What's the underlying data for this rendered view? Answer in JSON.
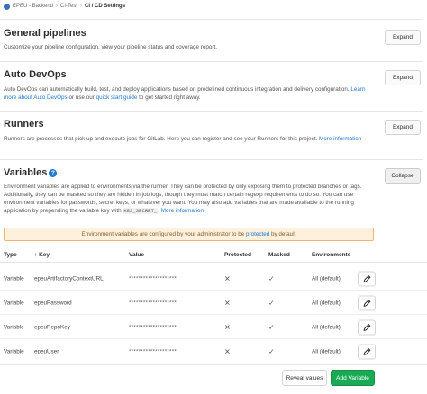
{
  "breadcrumb": {
    "items": [
      "EPEU - Backend",
      "CI-Test",
      "CI / CD Settings"
    ]
  },
  "sections": {
    "general": {
      "title": "General pipelines",
      "description": "Customize your pipeline configuration, view your pipeline status and coverage report.",
      "button": "Expand"
    },
    "autodevops": {
      "title": "Auto DevOps",
      "description": "Auto DevOps can automatically build, test, and deploy applications based on predefined continuous integration and delivery configuration.",
      "link1": "Learn more about Auto DevOps",
      "mid": " or use our ",
      "link2": "quick start guide",
      "tail": " to get started right away.",
      "button": "Expand"
    },
    "runners": {
      "title": "Runners",
      "description": "Runners are processes that pick up and execute jobs for GitLab. Here you can register and see your Runners for this project.",
      "link": "More information",
      "button": "Expand"
    },
    "variables": {
      "title": "Variables",
      "description_1": "Environment variables are applied to environments via the runner. They can be protected by only exposing them to protected branches or tags. Additionally, they can be masked so they are hidden in job logs, though they must match certain regexp requirements to do so. You can use environment variables for passwords, secret keys, or whatever you want. You may also add variables that are made available to the running application by prepending the variable key with",
      "code": "K8S_SECRET_",
      "description_2": ".",
      "link": "More information",
      "button": "Collapse"
    }
  },
  "alert": {
    "text_before": "Environment variables are configured by your administrator to be ",
    "link": "protected",
    "text_after": " by default"
  },
  "table": {
    "headers": {
      "type": "Type",
      "key": "Key",
      "value": "Value",
      "protected": "Protected",
      "masked": "Masked",
      "environments": "Environments"
    },
    "sort_arrow": "↑",
    "rows": [
      {
        "type": "Variable",
        "key": "epeuArtifactoryContextURL",
        "value": "********************",
        "protected": false,
        "masked": true,
        "environment": "All (default)"
      },
      {
        "type": "Variable",
        "key": "epeuPassword",
        "value": "********************",
        "protected": false,
        "masked": true,
        "environment": "All (default)"
      },
      {
        "type": "Variable",
        "key": "epeuRepoKey",
        "value": "********************",
        "protected": false,
        "masked": true,
        "environment": "All (default)"
      },
      {
        "type": "Variable",
        "key": "epeuUser",
        "value": "********************",
        "protected": false,
        "masked": true,
        "environment": "All (default)"
      }
    ]
  },
  "footer": {
    "reveal": "Reveal values",
    "add": "Add Variable"
  },
  "colors": {
    "link": "#1f78d1",
    "success": "#1aaa55",
    "alert_bg": "#fdf1dd",
    "alert_border": "#f0b46e"
  }
}
